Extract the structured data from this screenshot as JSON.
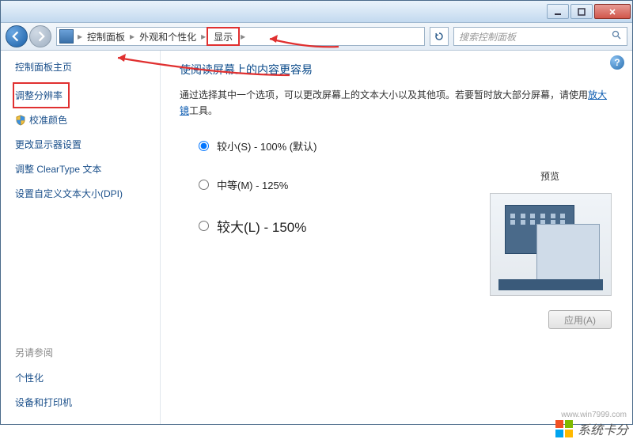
{
  "titlebar": {
    "min": "–",
    "max": "□",
    "close": "×"
  },
  "breadcrumb": {
    "items": [
      "控制面板",
      "外观和个性化",
      "显示"
    ],
    "search_placeholder": "搜索控制面板"
  },
  "sidebar": {
    "home": "控制面板主页",
    "items": [
      "调整分辨率",
      "校准颜色",
      "更改显示器设置",
      "调整 ClearType 文本",
      "设置自定义文本大小(DPI)"
    ],
    "see_also_title": "另请参阅",
    "see_also": [
      "个性化",
      "设备和打印机"
    ]
  },
  "main": {
    "title": "使阅读屏幕上的内容更容易",
    "desc_prefix": "通过选择其中一个选项，可以更改屏幕上的文本大小以及其他项。若要暂时放大部分屏幕，请使用",
    "desc_link": "放大镜",
    "desc_suffix": "工具。",
    "options": {
      "small": "较小(S) - 100% (默认)",
      "medium": "中等(M) - 125%",
      "large": "较大(L) - 150%"
    },
    "preview_label": "预览",
    "apply": "应用(A)"
  },
  "watermark": {
    "text": "系统卡分",
    "url": "www.win7999.com"
  }
}
